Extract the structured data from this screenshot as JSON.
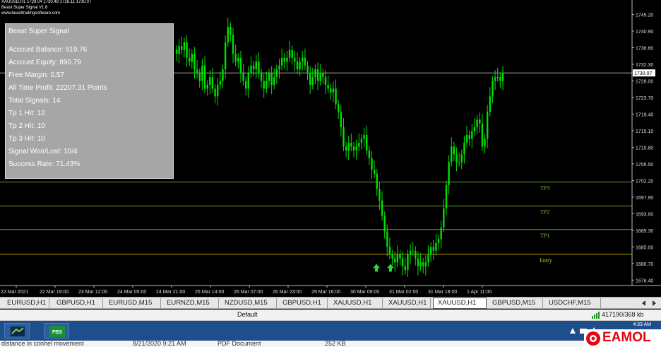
{
  "header": {
    "line1": "XAUUSD,H1  1729.04 1730.48 1726.11 1730.07",
    "line2": "Beast Super Signal V1.6",
    "line3": "www.beasttradingsoftware.com"
  },
  "panel": {
    "title": "Beast Super Signal",
    "lines": [
      "Account Balance: 919.76",
      "Account Equity: 890.79",
      "Free Margin: 0.57",
      "All Time Profit: 22207.31 Points",
      "Total Signals: 14",
      "Tp 1 Hit: 12",
      "Tp 2 Hit: 10",
      "Tp 3 Hit: 10",
      "Signal Won/Lost: 10/4",
      "Success Rate: 71.43%"
    ]
  },
  "chart_data": {
    "type": "candlestick",
    "symbol": "XAUUSD,H1",
    "price_axis_labels": [
      "1745.20",
      "1740.90",
      "1736.60",
      "1732.30",
      "1728.00",
      "1723.70",
      "1719.40",
      "1715.10",
      "1710.80",
      "1706.50",
      "1702.20",
      "1697.90",
      "1693.60",
      "1689.30",
      "1685.00",
      "1680.70",
      "1676.40"
    ],
    "current_price": "1730.07",
    "time_axis_labels": [
      "22 Mar 2021",
      "22 Mar 19:00",
      "23 Mar 12:00",
      "24 Mar 05:00",
      "24 Mar 21:00",
      "25 Mar 14:00",
      "26 Mar 07:00",
      "26 Mar 23:00",
      "29 Mar 16:00",
      "30 Mar 09:00",
      "31 Mar 02:00",
      "31 Mar 18:00",
      "1 Apr 11:00"
    ],
    "levels": [
      {
        "label": "TP3",
        "price": 1701.8,
        "color": "#7fbf3f"
      },
      {
        "label": "TP2",
        "price": 1695.6,
        "color": "#7fbf3f"
      },
      {
        "label": "TP1",
        "price": 1689.5,
        "color": "#7fbf3f"
      },
      {
        "label": "Entry",
        "price": 1683.1,
        "color": "#d8c400"
      }
    ],
    "close_path": [
      1735,
      1737,
      1736,
      1738,
      1734,
      1733,
      1735,
      1731,
      1730,
      1728,
      1732,
      1726,
      1727,
      1729,
      1726,
      1724,
      1727,
      1728,
      1731,
      1738,
      1742,
      1740,
      1735,
      1733,
      1734,
      1730,
      1728,
      1726,
      1730,
      1732,
      1731,
      1733,
      1730,
      1728,
      1726,
      1728,
      1730,
      1727,
      1729,
      1731,
      1732,
      1734,
      1733,
      1734,
      1736,
      1734,
      1733,
      1731,
      1733,
      1734,
      1732,
      1730,
      1727,
      1729,
      1731,
      1728,
      1730,
      1729,
      1727,
      1726,
      1725,
      1726,
      1722,
      1720,
      1716,
      1711,
      1710,
      1712,
      1711,
      1710,
      1711,
      1712,
      1713,
      1714,
      1710,
      1708,
      1705,
      1704,
      1700,
      1697,
      1693,
      1689,
      1685,
      1683,
      1682,
      1681,
      1683,
      1682,
      1680,
      1679,
      1683,
      1684,
      1684,
      1682,
      1680,
      1681,
      1680,
      1681,
      1683,
      1685,
      1684,
      1686,
      1687,
      1690,
      1695,
      1701,
      1707,
      1711,
      1709,
      1707,
      1707,
      1709,
      1712,
      1714,
      1713,
      1715,
      1716,
      1718,
      1717,
      1711,
      1713,
      1720,
      1724,
      1728,
      1729,
      1729,
      1728,
      1730
    ],
    "signals": [
      {
        "type": "buy",
        "price": 1679.5
      },
      {
        "type": "buy",
        "price": 1679.5
      }
    ],
    "ylim": [
      1675.0,
      1747.5
    ],
    "grid": false
  },
  "tabs": [
    {
      "label": "EURUSD,H1"
    },
    {
      "label": "GBPUSD,H1"
    },
    {
      "label": "EURUSD,M15"
    },
    {
      "label": "EURNZD,M15"
    },
    {
      "label": "NZDUSD,M15"
    },
    {
      "label": "GBPUSD,H1"
    },
    {
      "label": "XAUUSD,H1"
    },
    {
      "label": "XAUUSD,H1"
    },
    {
      "label": "XAUUSD,H1"
    },
    {
      "label": "GBPUSD,M15"
    },
    {
      "label": "USDCHF,M15"
    }
  ],
  "active_tab": 8,
  "status": {
    "profile": "Default",
    "memory": "417190/368 kb"
  },
  "taskbar": {
    "app1_label": "iC",
    "app2_label": "FBS",
    "time": "4:33 AM"
  },
  "bottom_strip": {
    "name": "distance in conhel movement",
    "date": "8/21/2020 9:21 AM",
    "type": "PDF Document",
    "size": "252 KB"
  },
  "watermark": {
    "text": "EAMOL",
    "color": "#e30613"
  }
}
